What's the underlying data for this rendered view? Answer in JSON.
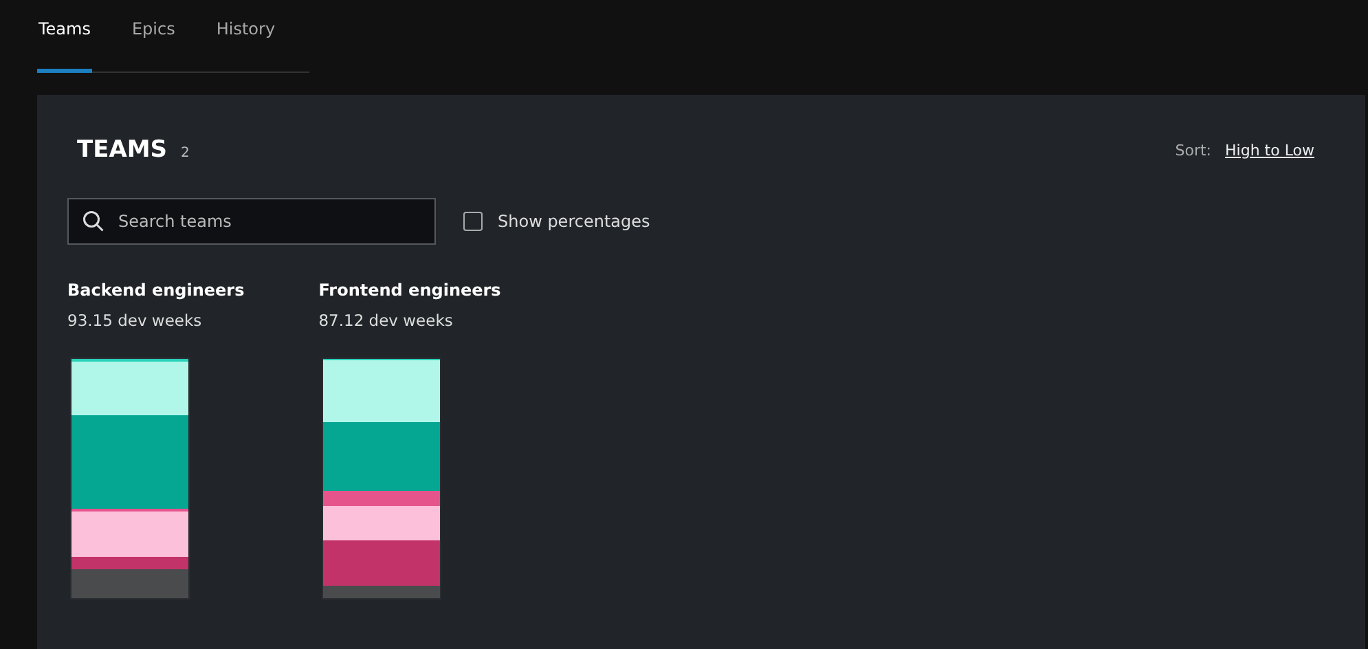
{
  "tabs": [
    {
      "label": "Teams",
      "selected": true
    },
    {
      "label": "Epics",
      "selected": false
    },
    {
      "label": "History",
      "selected": false
    }
  ],
  "header": {
    "title": "TEAMS",
    "count": "2",
    "sort_label": "Sort:",
    "sort_value": "High to Low"
  },
  "search": {
    "placeholder": "Search teams"
  },
  "show_percentages": {
    "label": "Show percentages",
    "checked": false
  },
  "teams": [
    {
      "name": "Backend engineers",
      "effort": "93.15 dev weeks",
      "segments": [
        {
          "color": "#2ad1b8"
        },
        {
          "color": "#b0f7ea"
        },
        {
          "color": "#05a692"
        },
        {
          "color": "#e5558c"
        },
        {
          "color": "#fdc0da"
        },
        {
          "color": "#c2336a"
        },
        {
          "color": "#4a4b4d"
        }
      ]
    },
    {
      "name": "Frontend engineers",
      "effort": "87.12 dev weeks",
      "segments": [
        {
          "color": "#2ad1b8"
        },
        {
          "color": "#b0f7ea"
        },
        {
          "color": "#05a692"
        },
        {
          "color": "#e5558c"
        },
        {
          "color": "#fdc0da"
        },
        {
          "color": "#c2336a"
        },
        {
          "color": "#4a4b4d"
        }
      ]
    }
  ]
}
